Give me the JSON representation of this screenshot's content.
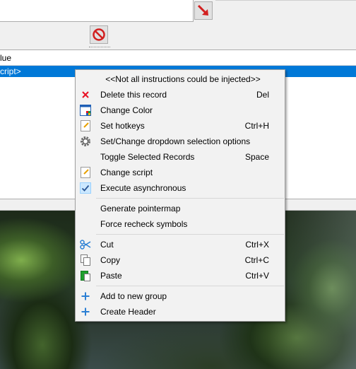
{
  "background": {
    "header_label": "lue",
    "selected_row_label": "cript>"
  },
  "menu": {
    "items": [
      {
        "label": "<<Not all instructions could be injected>>",
        "shortcut": "",
        "icon": "none"
      },
      {
        "label": "Delete this record",
        "shortcut": "Del",
        "icon": "red-x-icon"
      },
      {
        "label": "Change Color",
        "shortcut": "",
        "icon": "color-palette-icon"
      },
      {
        "label": "Set hotkeys",
        "shortcut": "Ctrl+H",
        "icon": "hotkey-icon"
      },
      {
        "label": "Set/Change dropdown selection options",
        "shortcut": "",
        "icon": "gear-icon"
      },
      {
        "label": "Toggle Selected Records",
        "shortcut": "Space",
        "icon": "none"
      },
      {
        "label": "Change script",
        "shortcut": "",
        "icon": "script-icon"
      },
      {
        "label": "Execute asynchronous",
        "shortcut": "",
        "icon": "checkmark-icon",
        "checked": true
      },
      {
        "label": "Generate pointermap",
        "shortcut": "",
        "icon": "none"
      },
      {
        "label": "Force recheck symbols",
        "shortcut": "",
        "icon": "none"
      },
      {
        "label": "Cut",
        "shortcut": "Ctrl+X",
        "icon": "scissors-icon"
      },
      {
        "label": "Copy",
        "shortcut": "Ctrl+C",
        "icon": "copy-icon"
      },
      {
        "label": "Paste",
        "shortcut": "Ctrl+V",
        "icon": "paste-icon"
      },
      {
        "label": "Add to new group",
        "shortcut": "",
        "icon": "plus-icon"
      },
      {
        "label": "Create Header",
        "shortcut": "",
        "icon": "plus-icon"
      }
    ]
  },
  "colors": {
    "selection": "#0078d7",
    "menu_bg": "#f2f2f2",
    "check_bg": "#cce8ff",
    "accent_blue": "#2b7fd4",
    "delete_red": "#e81123"
  }
}
